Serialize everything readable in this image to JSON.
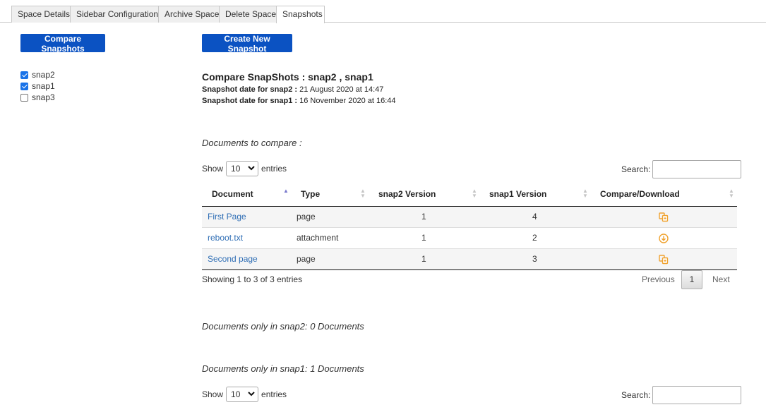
{
  "tabs": [
    {
      "label": "Space Details"
    },
    {
      "label": "Sidebar Configuration"
    },
    {
      "label": "Archive Space"
    },
    {
      "label": "Delete Space"
    },
    {
      "label": "Snapshots"
    }
  ],
  "buttons": {
    "compare_snapshots": "Compare Snapshots",
    "create_new_snapshot": "Create New Snapshot"
  },
  "snapshots": [
    {
      "label": "snap2",
      "checked": true
    },
    {
      "label": "snap1",
      "checked": true
    },
    {
      "label": "snap3",
      "checked": false
    }
  ],
  "compare": {
    "title": "Compare SnapShots : snap2 , snap1",
    "date_snap2_label": "Snapshot date for snap2 :",
    "date_snap2_value": "21 August 2020 at 14:47",
    "date_snap1_label": "Snapshot date for snap1 :",
    "date_snap1_value": "16 November 2020 at 16:44"
  },
  "documents_to_compare": {
    "heading": "Documents to compare :",
    "show_label": "Show",
    "entries_value": "10",
    "entries_label": "entries",
    "search_label": "Search:",
    "columns": [
      "Document",
      "Type",
      "snap2 Version",
      "snap1 Version",
      "Compare/Download"
    ],
    "rows": [
      {
        "document": "First Page",
        "type": "page",
        "snap2": "1",
        "snap1": "4",
        "action_icon": "compare-icon"
      },
      {
        "document": "reboot.txt",
        "type": "attachment",
        "snap2": "1",
        "snap1": "2",
        "action_icon": "download-icon"
      },
      {
        "document": "Second page",
        "type": "page",
        "snap2": "1",
        "snap1": "3",
        "action_icon": "compare-icon"
      }
    ],
    "showing": "Showing 1 to 3 of 3 entries",
    "pagination": {
      "previous": "Previous",
      "page": "1",
      "next": "Next"
    }
  },
  "only_in_snap2": "Documents only in snap2: 0 Documents",
  "only_in_snap1": {
    "heading": "Documents only in snap1: 1 Documents",
    "show_label": "Show",
    "entries_value": "10",
    "entries_label": "entries",
    "search_label": "Search:"
  },
  "colors": {
    "button": "#0b52c2",
    "link": "#2f6eb5",
    "icon": "#f0a22e"
  }
}
